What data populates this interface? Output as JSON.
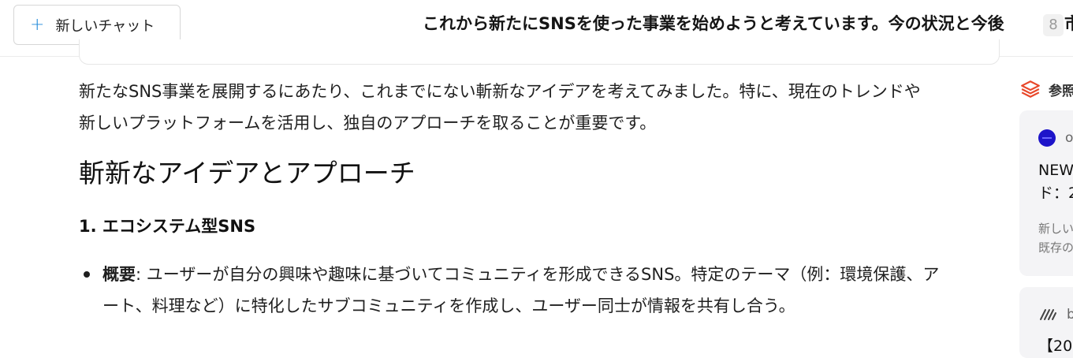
{
  "header": {
    "new_chat_label": "新しいチャット",
    "title": "これから新たにSNSを使った事業を始めようと考えています。今の状況と今後",
    "badge": "8",
    "title_tail": "市"
  },
  "content": {
    "intro_line1": "新たなSNS事業を展開するにあたり、これまでにない斬新なアイデアを考えてみました。特に、現在のトレンドや",
    "intro_line2": "新しいプラットフォームを活用し、独自のアプローチを取ることが重要です。",
    "heading": "斬新なアイデアとアプローチ",
    "subheading": "1. エコシステム型SNS",
    "bullets": [
      {
        "label": "概要",
        "separator": ": ",
        "line1": "ユーザーが自分の興味や趣味に基づいてコミュニティを形成できるSNS。特定のテーマ（例：環境保護、ア",
        "line2": "ート、料理など）に特化したサブコミュニティを作成し、ユーザー同士が情報を共有し合う。"
      }
    ]
  },
  "references": {
    "label": "参照",
    "cards": [
      {
        "source": "o",
        "title_line1": "NEW",
        "title_line2": "ド：2",
        "snippet_line1": "新しい",
        "snippet_line2": "既存の"
      },
      {
        "source": "b",
        "title_line1": "【20"
      }
    ]
  },
  "colors": {
    "accent_plus": "#1e88d9",
    "ref_icon": "#e8472a",
    "source_icon": "#1d14c9"
  }
}
